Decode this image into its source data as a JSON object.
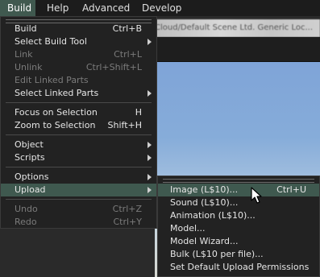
{
  "menubar": {
    "items": [
      {
        "label": "Build",
        "active": true
      },
      {
        "label": "Help",
        "active": false
      },
      {
        "label": "Advanced",
        "active": false
      },
      {
        "label": "Develop",
        "active": false
      }
    ]
  },
  "background": {
    "blurred_text": "Cloud/Default Scene Ltd. Generic Loc..."
  },
  "build_menu": {
    "items": [
      {
        "label": "Build",
        "shortcut": "Ctrl+B",
        "enabled": true
      },
      {
        "label": "Select Build Tool",
        "shortcut": "",
        "submenu": true,
        "enabled": true
      },
      {
        "label": "Link",
        "shortcut": "Ctrl+L",
        "enabled": false
      },
      {
        "label": "Unlink",
        "shortcut": "Ctrl+Shift+L",
        "enabled": false
      },
      {
        "label": "Edit Linked Parts",
        "shortcut": "",
        "enabled": false
      },
      {
        "label": "Select Linked Parts",
        "shortcut": "",
        "submenu": true,
        "enabled": true
      },
      {
        "label": "Focus on Selection",
        "shortcut": "H",
        "enabled": true
      },
      {
        "label": "Zoom to Selection",
        "shortcut": "Shift+H",
        "enabled": true
      },
      {
        "label": "Object",
        "shortcut": "",
        "submenu": true,
        "enabled": true
      },
      {
        "label": "Scripts",
        "shortcut": "",
        "submenu": true,
        "enabled": true
      },
      {
        "label": "Options",
        "shortcut": "",
        "submenu": true,
        "enabled": true
      },
      {
        "label": "Upload",
        "shortcut": "",
        "submenu": true,
        "enabled": true,
        "highlighted": true
      },
      {
        "label": "Undo",
        "shortcut": "Ctrl+Z",
        "enabled": false
      },
      {
        "label": "Redo",
        "shortcut": "Ctrl+Y",
        "enabled": false
      }
    ]
  },
  "upload_menu": {
    "items": [
      {
        "label": "Image (L$10)...",
        "shortcut": "Ctrl+U",
        "highlighted": true
      },
      {
        "label": "Sound (L$10)...",
        "shortcut": ""
      },
      {
        "label": "Animation (L$10)...",
        "shortcut": ""
      },
      {
        "label": "Model...",
        "shortcut": ""
      },
      {
        "label": "Model Wizard...",
        "shortcut": ""
      },
      {
        "label": "Bulk (L$10 per file)...",
        "shortcut": ""
      },
      {
        "label": "Set Default Upload Permissions",
        "shortcut": ""
      }
    ]
  },
  "colors": {
    "menu_bg": "#222222",
    "highlight": "#3f594f",
    "text": "#e6e6e6",
    "disabled_text": "#7b7b7b"
  }
}
